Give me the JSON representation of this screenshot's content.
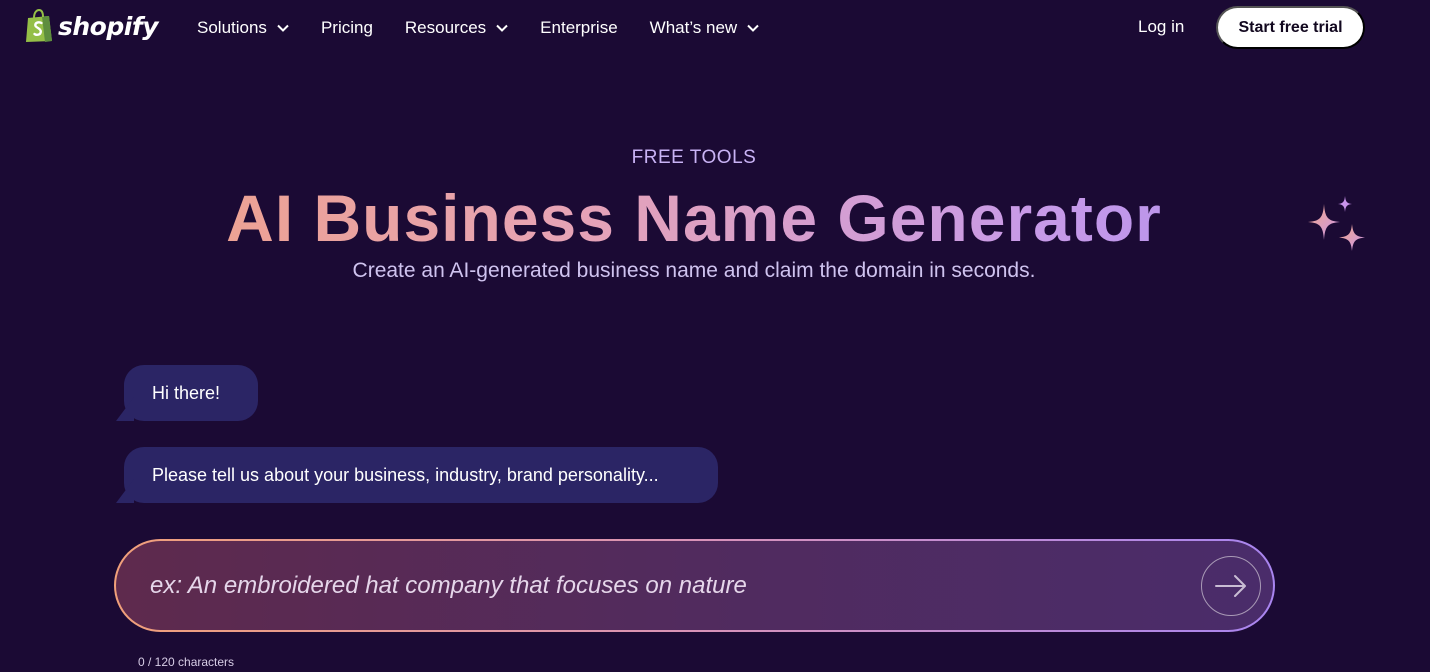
{
  "nav": {
    "logo_text": "shopify",
    "items": [
      {
        "label": "Solutions",
        "dropdown": true
      },
      {
        "label": "Pricing",
        "dropdown": false
      },
      {
        "label": "Resources",
        "dropdown": true
      },
      {
        "label": "Enterprise",
        "dropdown": false
      },
      {
        "label": "What’s new",
        "dropdown": true
      }
    ],
    "login": "Log in",
    "cta": "Start free trial"
  },
  "hero": {
    "eyebrow": "FREE TOOLS",
    "title": "AI Business Name Generator",
    "subtitle": "Create an AI-generated business name and claim the domain in seconds."
  },
  "chat": {
    "messages": [
      "Hi there!",
      "Please tell us about your business, industry, brand personality..."
    ]
  },
  "input": {
    "placeholder": "ex: An embroidered hat company that focuses on nature",
    "value": "",
    "counter": "0 / 120 characters"
  },
  "colors": {
    "background": "#1b0a34",
    "bubble": "#2b2565",
    "brand_green": "#95bf47"
  },
  "icons": {
    "logo": "shopify-bag-icon",
    "dropdown": "chevron-down-icon",
    "sparkle": "sparkles-icon",
    "send": "arrow-right-icon"
  }
}
